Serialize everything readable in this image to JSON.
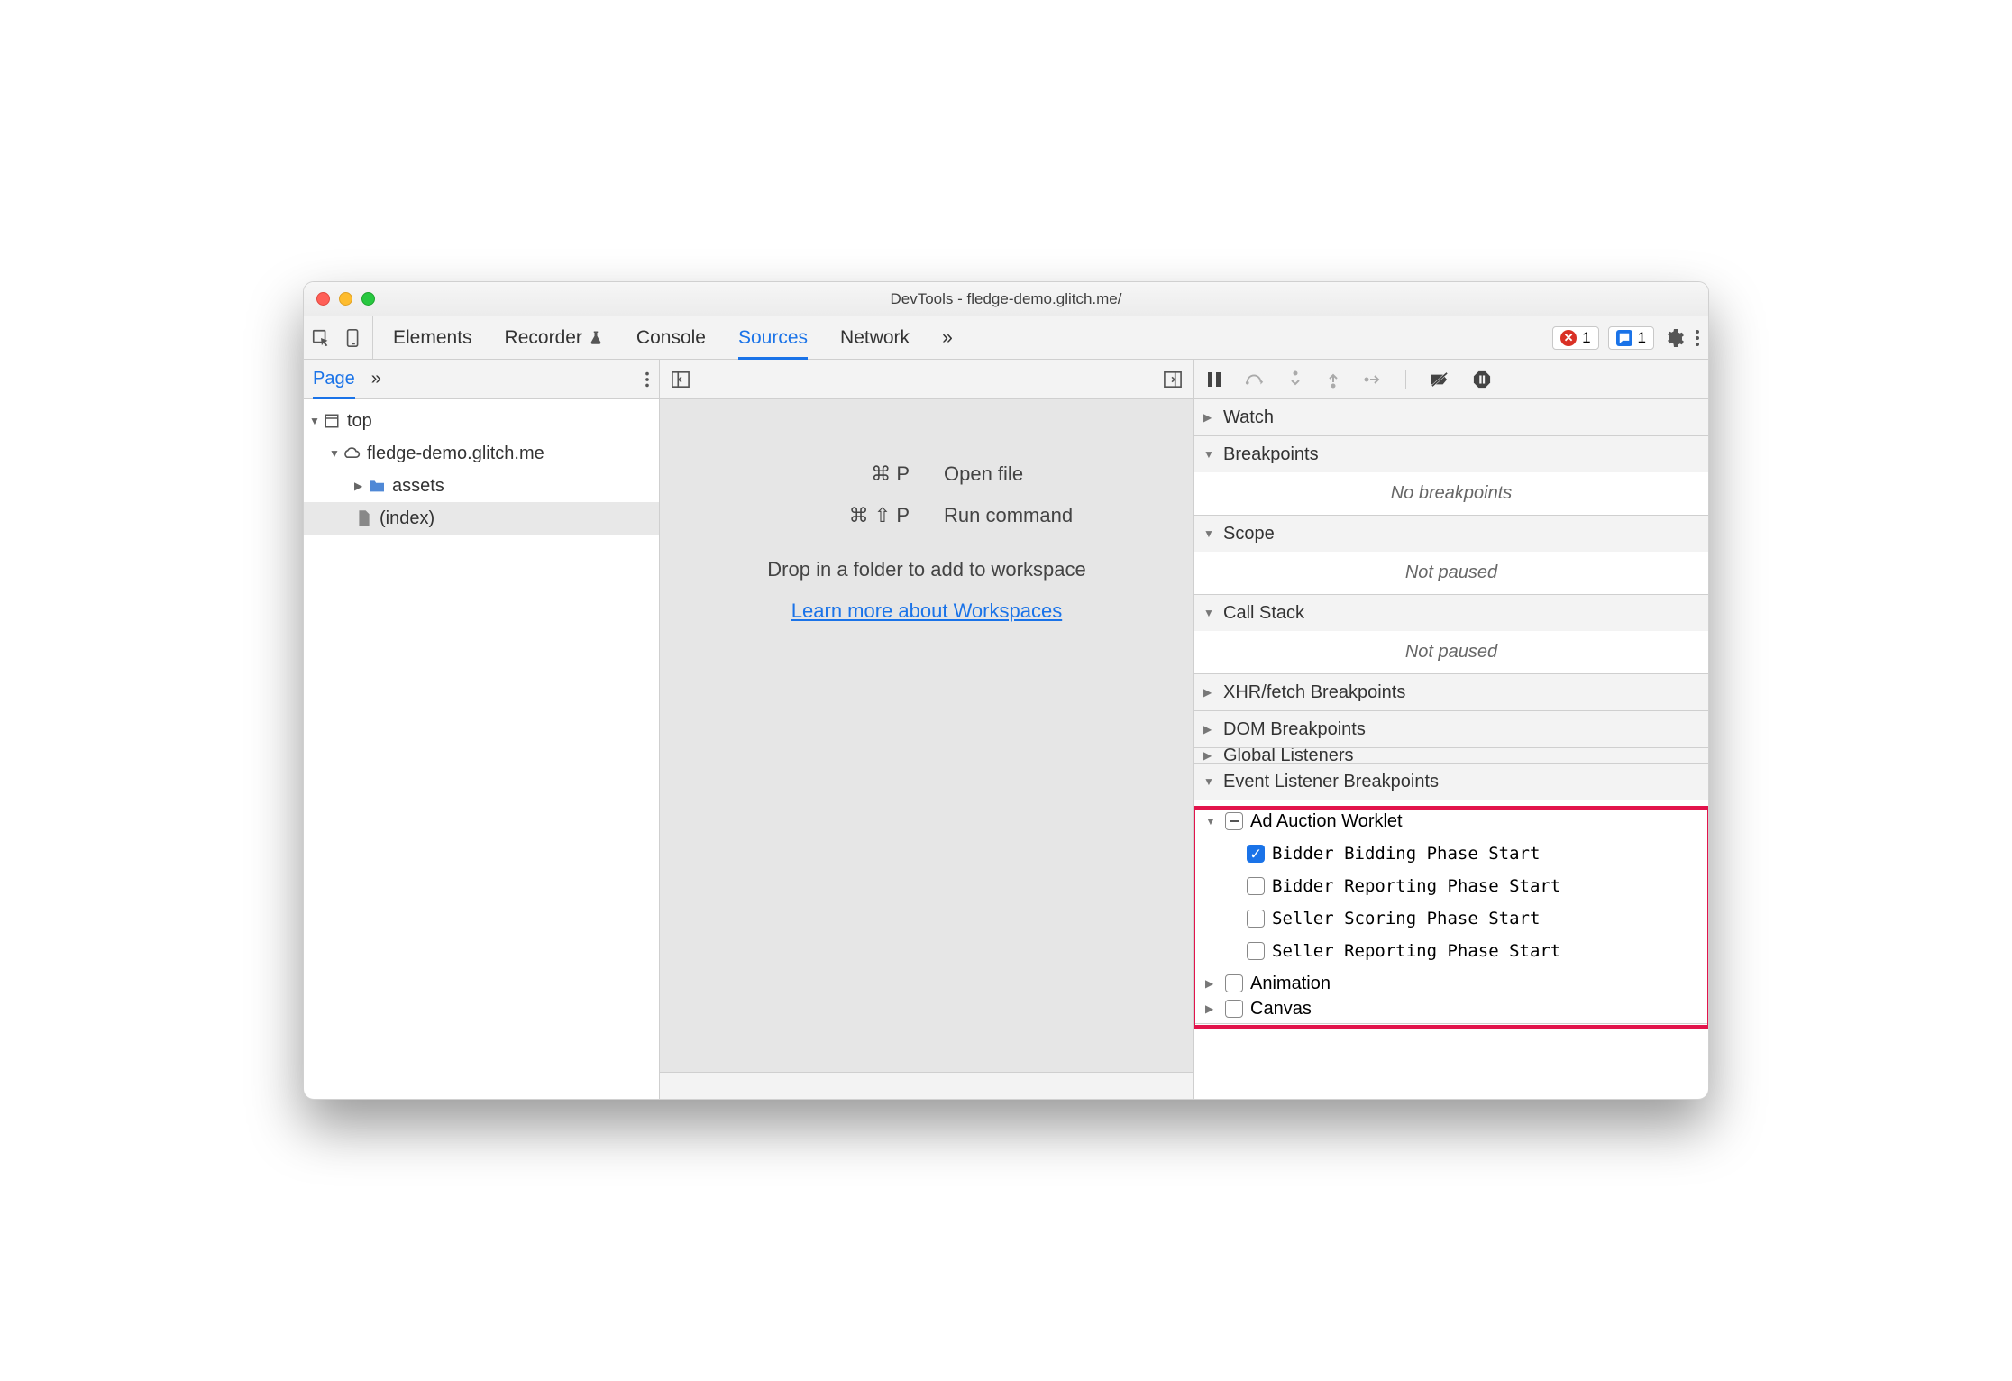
{
  "window": {
    "title": "DevTools - fledge-demo.glitch.me/"
  },
  "toolbar": {
    "tabs": [
      "Elements",
      "Recorder",
      "Console",
      "Sources",
      "Network"
    ],
    "active": "Sources",
    "overflow": "»",
    "errors": "1",
    "messages": "1"
  },
  "left": {
    "tab": "Page",
    "overflow": "»",
    "tree": {
      "top": "top",
      "origin": "fledge-demo.glitch.me",
      "folder": "assets",
      "file": "(index)"
    }
  },
  "mid": {
    "open_key": "⌘ P",
    "open_label": "Open file",
    "run_key": "⌘ ⇧ P",
    "run_label": "Run command",
    "drop": "Drop in a folder to add to workspace",
    "learn": "Learn more about Workspaces"
  },
  "right": {
    "sections": {
      "watch": "Watch",
      "breakpoints": "Breakpoints",
      "breakpoints_empty": "No breakpoints",
      "scope": "Scope",
      "scope_empty": "Not paused",
      "callstack": "Call Stack",
      "callstack_empty": "Not paused",
      "xhr": "XHR/fetch Breakpoints",
      "dom": "DOM Breakpoints",
      "global": "Global Listeners",
      "event": "Event Listener Breakpoints"
    },
    "ad_auction": {
      "group": "Ad Auction Worklet",
      "items": [
        {
          "label": "Bidder Bidding Phase Start",
          "checked": true
        },
        {
          "label": "Bidder Reporting Phase Start",
          "checked": false
        },
        {
          "label": "Seller Scoring Phase Start",
          "checked": false
        },
        {
          "label": "Seller Reporting Phase Start",
          "checked": false
        }
      ]
    },
    "animation": "Animation",
    "canvas": "Canvas"
  }
}
